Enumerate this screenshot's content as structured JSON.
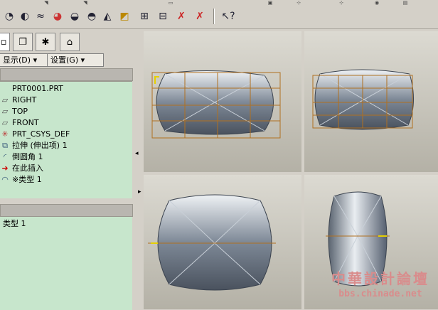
{
  "menu": {
    "display_label": "显示(D)",
    "settings_label": "设置(G)"
  },
  "tree": {
    "items": [
      {
        "label": "PRT0001.PRT",
        "icon": "part-icon"
      },
      {
        "label": "RIGHT",
        "icon": "datum-plane-icon"
      },
      {
        "label": "TOP",
        "icon": "datum-plane-icon"
      },
      {
        "label": "FRONT",
        "icon": "datum-plane-icon"
      },
      {
        "label": "PRT_CSYS_DEF",
        "icon": "csys-icon"
      },
      {
        "label": "拉伸 (伸出项) 1",
        "icon": "extrude-icon"
      },
      {
        "label": "倒圆角 1",
        "icon": "round-icon"
      },
      {
        "label": "在此插入",
        "icon": "insert-here-arrow-icon"
      },
      {
        "label": "※类型 1",
        "icon": "type-icon"
      }
    ]
  },
  "layer_tree": {
    "items": [
      {
        "label": "类型 1"
      }
    ]
  },
  "watermark": {
    "title": "中華設計論壇",
    "url": "bbs.chinade.net"
  },
  "colors": {
    "tree_bg": "#c7e6cc",
    "panel_bg": "#d4d0c8",
    "grid_line": "#b07020",
    "watermark": "#d98c8c"
  }
}
